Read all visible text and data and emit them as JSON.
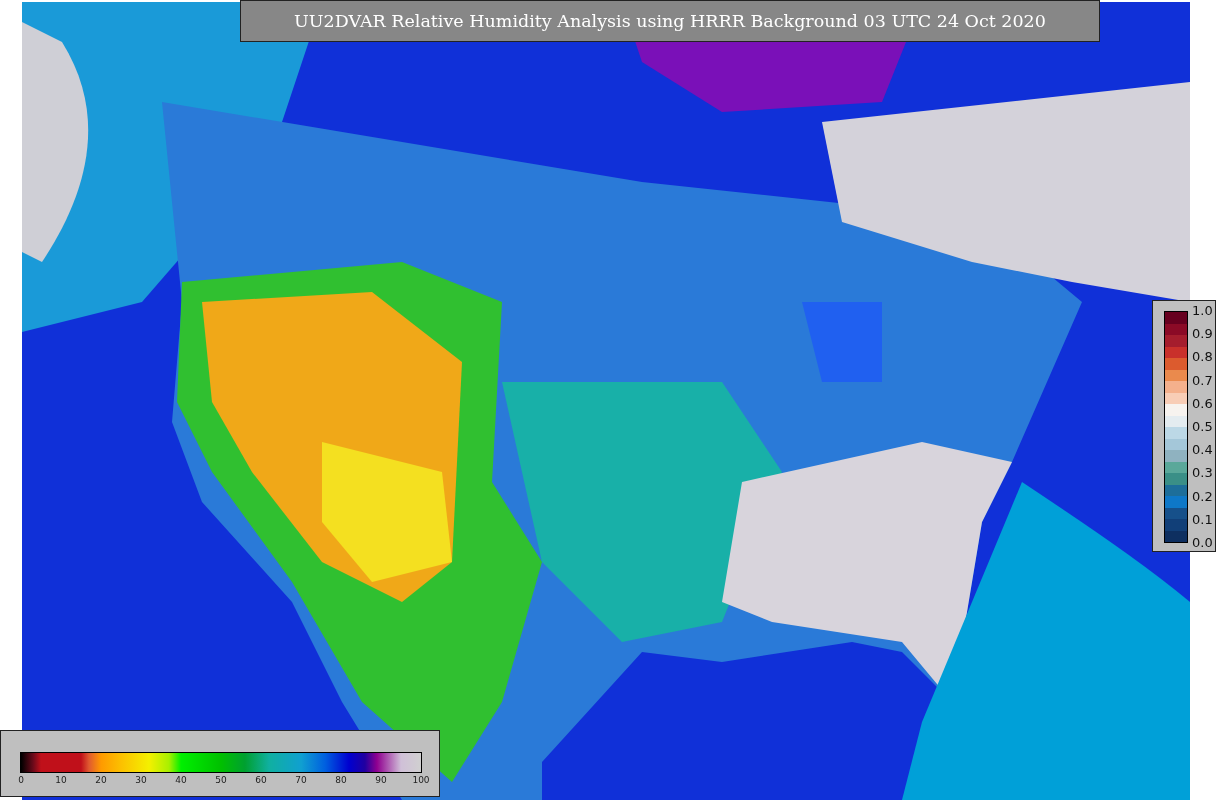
{
  "title": "UU2DVAR Relative Humidity Analysis using HRRR Background 03 UTC 24 Oct 2020",
  "humidity_colorbar": {
    "ticks": [
      "0",
      "10",
      "20",
      "30",
      "40",
      "50",
      "60",
      "70",
      "80",
      "90",
      "100"
    ]
  },
  "side_colorbar": {
    "ticks": [
      "1.0",
      "0.9",
      "0.8",
      "0.7",
      "0.6",
      "0.5",
      "0.4",
      "0.3",
      "0.2",
      "0.1",
      "0.0"
    ]
  }
}
